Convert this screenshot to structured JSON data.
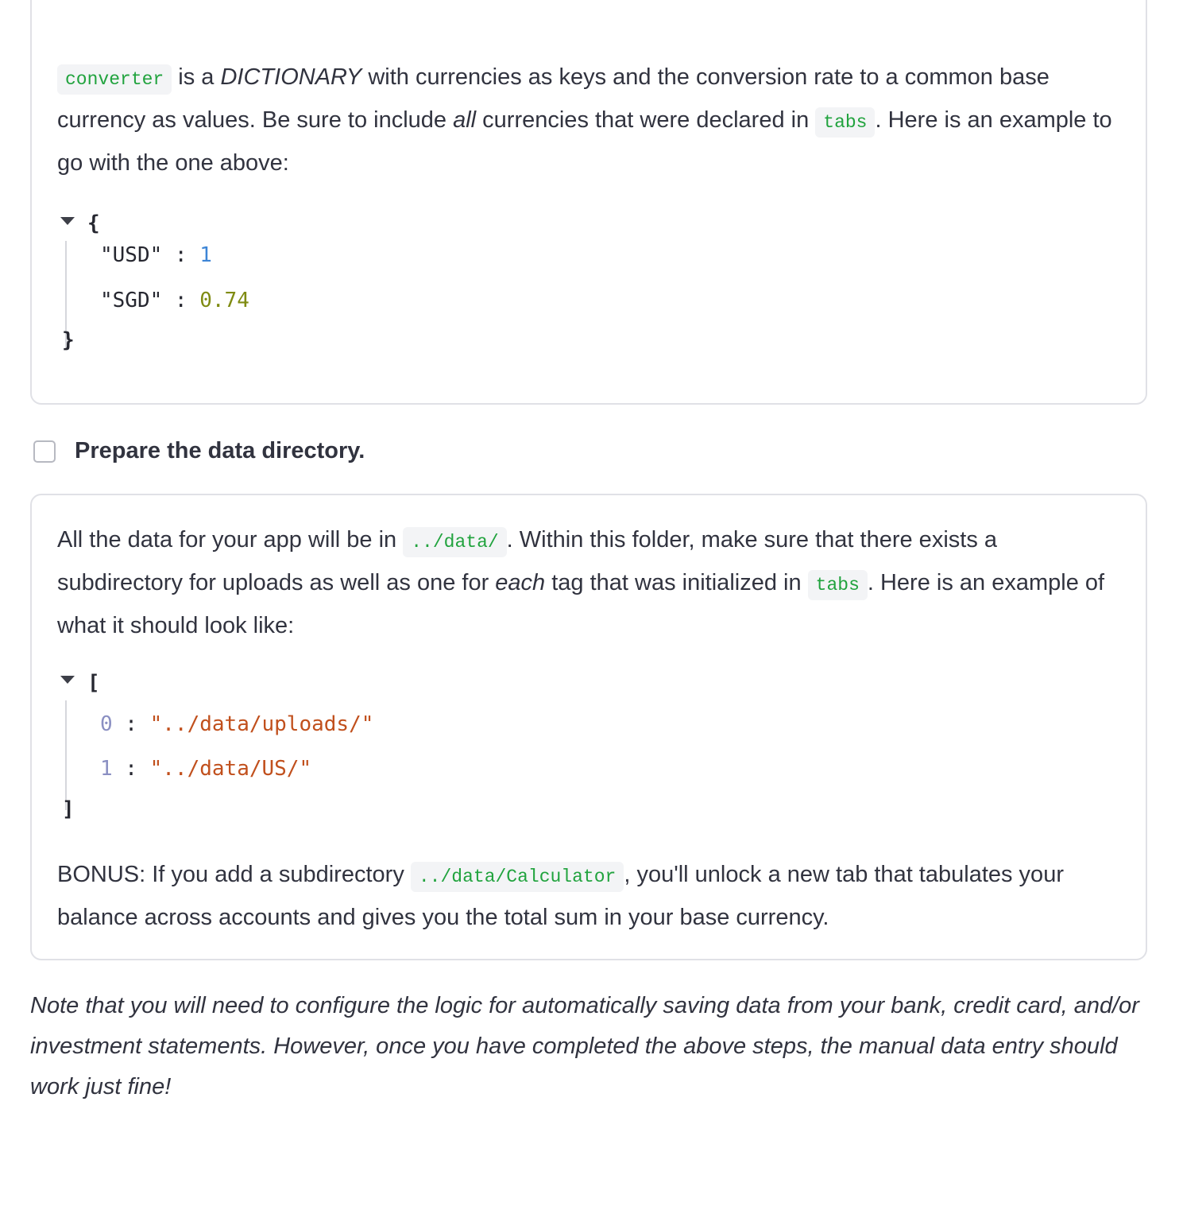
{
  "converter_section": {
    "code_converter": "converter",
    "t1": " is a ",
    "dictionary": "DICTIONARY",
    "t2": " with currencies as keys and the conversion rate to a common base currency as values. Be sure to include ",
    "all": "all",
    "t3": " currencies that were declared in ",
    "code_tabs": "tabs",
    "t4": ". Here is an example to go with the one above:",
    "json_example": {
      "open": "{",
      "close": "}",
      "rows": [
        {
          "key": "\"USD\"",
          "sep": " : ",
          "value": "1"
        },
        {
          "key": "\"SGD\"",
          "sep": " : ",
          "value": "0.74"
        }
      ]
    }
  },
  "task": {
    "label": "Prepare the data directory.",
    "checked": false
  },
  "data_section": {
    "t1": "All the data for your app will be in ",
    "code_data": "../data/",
    "t2": ". Within this folder, make sure that there exists a subdirectory for uploads as well as one for ",
    "each": "each",
    "t3": " tag that was initialized in ",
    "code_tabs": "tabs",
    "t4": ". Here is an example of what it should look like:",
    "json_example": {
      "open": "[",
      "close": "]",
      "rows": [
        {
          "index": "0",
          "sep": " : ",
          "value": "\"../data/uploads/\""
        },
        {
          "index": "1",
          "sep": " : ",
          "value": "\"../data/US/\""
        }
      ]
    },
    "bonus_t1": "BONUS: If you add a subdirectory ",
    "code_calculator": "../data/Calculator",
    "bonus_t2": ", you'll unlock a new tab that tabulates your balance across accounts and gives you the total sum in your base currency."
  },
  "note": "Note that you will need to configure the logic for automatically saving data from your bank, credit card, and/or investment statements. However, once you have completed the above steps, the manual data entry should work just fine!"
}
